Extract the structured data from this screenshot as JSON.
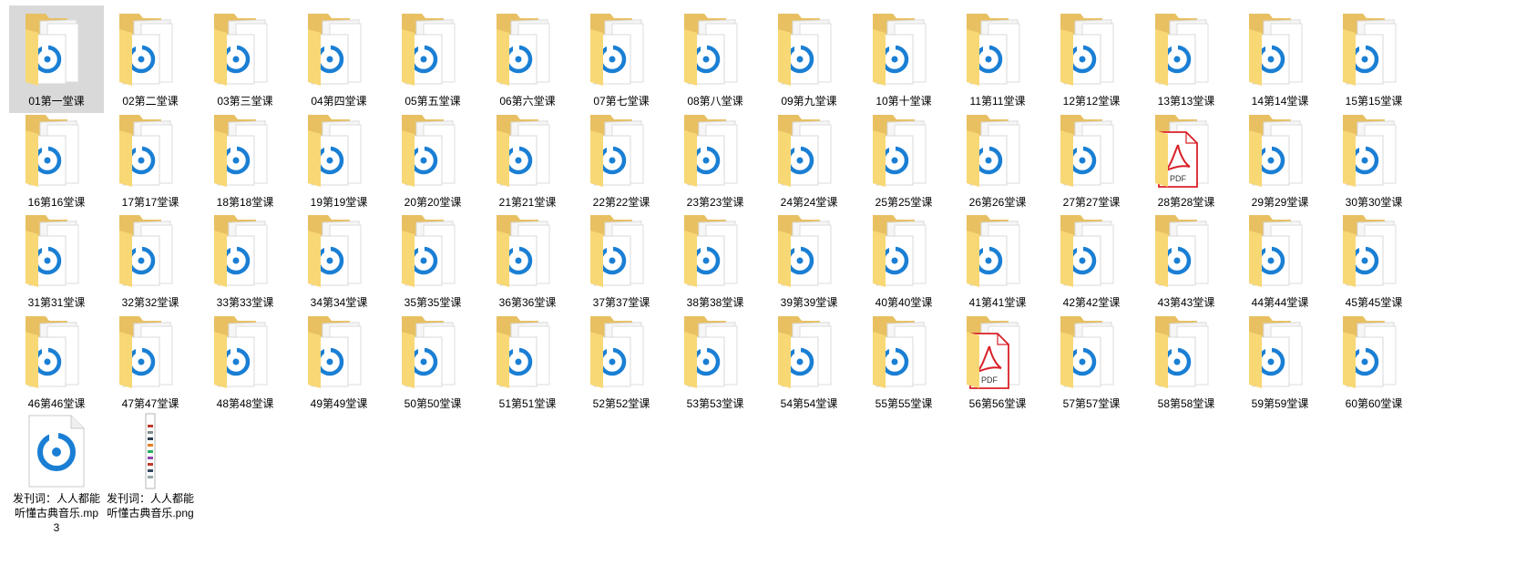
{
  "folders": [
    {
      "label": "01第一堂课",
      "thumb": "music"
    },
    {
      "label": "02第二堂课",
      "thumb": "music"
    },
    {
      "label": "03第三堂课",
      "thumb": "music"
    },
    {
      "label": "04第四堂课",
      "thumb": "music"
    },
    {
      "label": "05第五堂课",
      "thumb": "music"
    },
    {
      "label": "06第六堂课",
      "thumb": "music"
    },
    {
      "label": "07第七堂课",
      "thumb": "music"
    },
    {
      "label": "08第八堂课",
      "thumb": "music"
    },
    {
      "label": "09第九堂课",
      "thumb": "music"
    },
    {
      "label": "10第十堂课",
      "thumb": "music"
    },
    {
      "label": "11第11堂课",
      "thumb": "music"
    },
    {
      "label": "12第12堂课",
      "thumb": "music"
    },
    {
      "label": "13第13堂课",
      "thumb": "music"
    },
    {
      "label": "14第14堂课",
      "thumb": "music"
    },
    {
      "label": "15第15堂课",
      "thumb": "music"
    },
    {
      "label": "16第16堂课",
      "thumb": "music"
    },
    {
      "label": "17第17堂课",
      "thumb": "music"
    },
    {
      "label": "18第18堂课",
      "thumb": "music"
    },
    {
      "label": "19第19堂课",
      "thumb": "music"
    },
    {
      "label": "20第20堂课",
      "thumb": "music"
    },
    {
      "label": "21第21堂课",
      "thumb": "music"
    },
    {
      "label": "22第22堂课",
      "thumb": "music"
    },
    {
      "label": "23第23堂课",
      "thumb": "music"
    },
    {
      "label": "24第24堂课",
      "thumb": "music"
    },
    {
      "label": "25第25堂课",
      "thumb": "music"
    },
    {
      "label": "26第26堂课",
      "thumb": "music"
    },
    {
      "label": "27第27堂课",
      "thumb": "music"
    },
    {
      "label": "28第28堂课",
      "thumb": "pdf"
    },
    {
      "label": "29第29堂课",
      "thumb": "music"
    },
    {
      "label": "30第30堂课",
      "thumb": "music"
    },
    {
      "label": "31第31堂课",
      "thumb": "music"
    },
    {
      "label": "32第32堂课",
      "thumb": "music"
    },
    {
      "label": "33第33堂课",
      "thumb": "music"
    },
    {
      "label": "34第34堂课",
      "thumb": "music"
    },
    {
      "label": "35第35堂课",
      "thumb": "music"
    },
    {
      "label": "36第36堂课",
      "thumb": "music"
    },
    {
      "label": "37第37堂课",
      "thumb": "music"
    },
    {
      "label": "38第38堂课",
      "thumb": "music"
    },
    {
      "label": "39第39堂课",
      "thumb": "music"
    },
    {
      "label": "40第40堂课",
      "thumb": "music"
    },
    {
      "label": "41第41堂课",
      "thumb": "music"
    },
    {
      "label": "42第42堂课",
      "thumb": "music"
    },
    {
      "label": "43第43堂课",
      "thumb": "music"
    },
    {
      "label": "44第44堂课",
      "thumb": "music"
    },
    {
      "label": "45第45堂课",
      "thumb": "music"
    },
    {
      "label": "46第46堂课",
      "thumb": "music"
    },
    {
      "label": "47第47堂课",
      "thumb": "music"
    },
    {
      "label": "48第48堂课",
      "thumb": "music"
    },
    {
      "label": "49第49堂课",
      "thumb": "music"
    },
    {
      "label": "50第50堂课",
      "thumb": "music"
    },
    {
      "label": "51第51堂课",
      "thumb": "music"
    },
    {
      "label": "52第52堂课",
      "thumb": "music"
    },
    {
      "label": "53第53堂课",
      "thumb": "music"
    },
    {
      "label": "54第54堂课",
      "thumb": "music"
    },
    {
      "label": "55第55堂课",
      "thumb": "music"
    },
    {
      "label": "56第56堂课",
      "thumb": "pdf"
    },
    {
      "label": "57第57堂课",
      "thumb": "music"
    },
    {
      "label": "58第58堂课",
      "thumb": "music"
    },
    {
      "label": "59第59堂课",
      "thumb": "music"
    },
    {
      "label": "60第60堂课",
      "thumb": "music"
    }
  ],
  "files": [
    {
      "label": "发刊词：人人都能听懂古典音乐.mp3",
      "icon": "music-file-icon"
    },
    {
      "label": "发刊词：人人都能听懂古典音乐.png",
      "icon": "image-file-icon"
    }
  ],
  "selected_index": 0,
  "colors": {
    "folder_back": "#e8c062",
    "folder_front": "#f8d775",
    "music_blue": "#1a7fd4",
    "pdf_red": "#d92027",
    "selection": "#d9d9d9"
  },
  "icons": {
    "music": "music-note-icon",
    "pdf": "pdf-icon"
  },
  "pdf_text": "PDF"
}
